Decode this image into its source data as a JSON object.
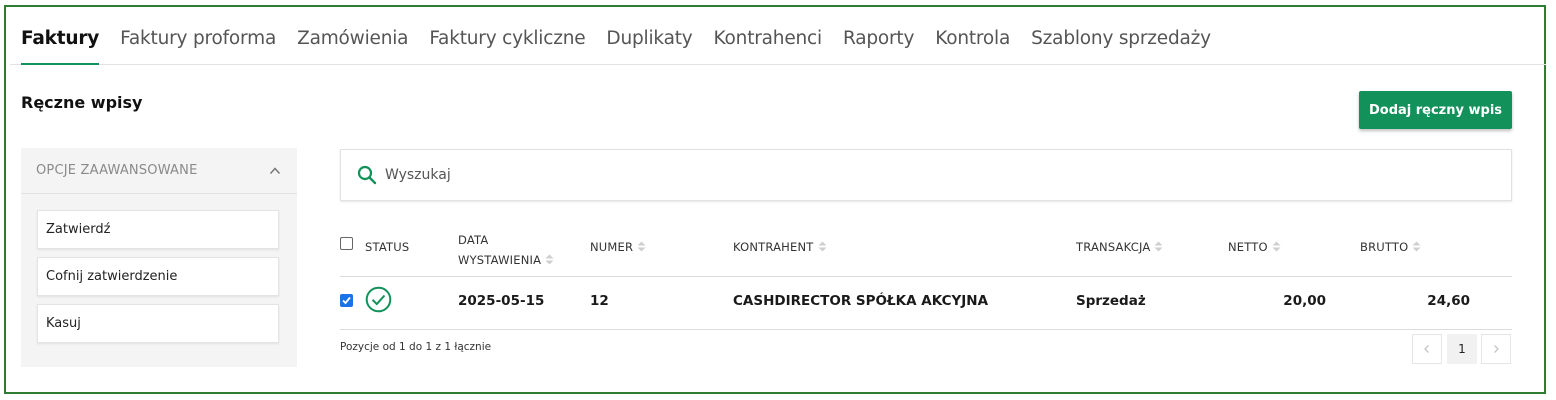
{
  "tabs": [
    {
      "label": "Faktury",
      "active": true
    },
    {
      "label": "Faktury proforma"
    },
    {
      "label": "Zamówienia"
    },
    {
      "label": "Faktury cykliczne"
    },
    {
      "label": "Duplikaty"
    },
    {
      "label": "Kontrahenci"
    },
    {
      "label": "Raporty"
    },
    {
      "label": "Kontrola"
    },
    {
      "label": "Szablony sprzedaży"
    }
  ],
  "section_title": "Ręczne wpisy",
  "primary_action": "Dodaj ręczny wpis",
  "sidebar": {
    "header": "OPCJE ZAAWANSOWANE",
    "buttons": [
      "Zatwierdź",
      "Cofnij zatwierdzenie",
      "Kasuj"
    ]
  },
  "search": {
    "placeholder": "Wyszukaj",
    "value": ""
  },
  "table": {
    "headers": {
      "status": "STATUS",
      "date_line1": "DATA",
      "date_line2": "WYSTAWIENIA",
      "number": "NUMER",
      "contractor": "KONTRAHENT",
      "transaction": "TRANSAKCJA",
      "net": "NETTO",
      "gross": "BRUTTO"
    },
    "rows": [
      {
        "checked": true,
        "status": "approved",
        "date": "2025-05-15",
        "number": "12",
        "contractor": "CASHDIRECTOR SPÓŁKA AKCYJNA",
        "transaction": "Sprzedaż",
        "net": "20,00",
        "gross": "24,60"
      }
    ]
  },
  "pagination": {
    "info": "Pozycje od 1 do 1 z 1 łącznie",
    "current_page": "1"
  },
  "colors": {
    "accent": "#12925a",
    "frame": "#2e7d32",
    "checkbox": "#1a73e8"
  },
  "icons": {
    "search": "search-icon",
    "collapse": "chevron-up-icon",
    "status": "check-circle-icon",
    "sort": "sort-icon",
    "prev": "chevron-left-icon",
    "next": "chevron-right-icon"
  }
}
